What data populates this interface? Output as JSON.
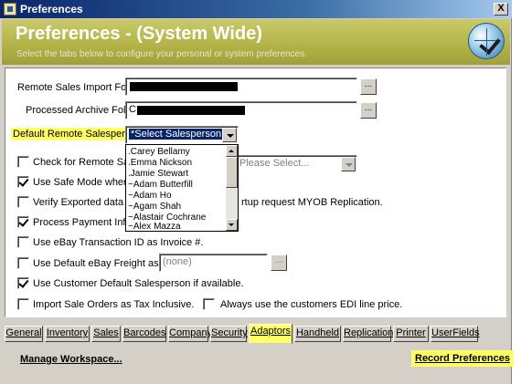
{
  "window": {
    "title": "Preferences",
    "close_label": "X"
  },
  "header": {
    "title": "Preferences - (System Wide)",
    "subtitle": "Select the tabs below to configure your personal or system preferences."
  },
  "fields": {
    "remote_import_label": "Remote Sales Import Folder :",
    "processed_archive_label": "Processed Archive Folder :",
    "processed_archive_value_prefix": "C",
    "default_salesperson_label": "Default Remote Salesperson :",
    "default_salesperson_value": "*Select Salesperson",
    "browse_label": "...",
    "please_select": "Please Select...",
    "freight_item_value": "(none)"
  },
  "salesperson_options": [
    ".Carey Bellamy",
    ".Emma Nickson",
    ".Jamie Stewart",
    "~Adam Butterfill",
    "~Adam Ho",
    "~Agam Shah",
    "~Alastair Cochrane",
    "~Alex Mazza"
  ],
  "checkboxes": [
    {
      "label": "Check for Remote Sales at",
      "checked": false
    },
    {
      "label": "Use Safe Mode when Expo",
      "checked": true
    },
    {
      "label": "Verify Exported data after N",
      "checked": false
    },
    {
      "label": "Process Payment Informati",
      "checked": true
    },
    {
      "label": "Use eBay Transaction ID as Invoice #.",
      "checked": false
    },
    {
      "label": "Use Default eBay Freight as Item :",
      "checked": false
    },
    {
      "label": "Use Customer Default Salesperson if available.",
      "checked": true
    },
    {
      "label": "Import Sale Orders as Tax Inclusive.",
      "checked": false
    },
    {
      "label": "Always use the customers EDI line price.",
      "checked": false
    }
  ],
  "startup_text": "rtup request MYOB Replication.",
  "tabs": [
    "General",
    "Inventory",
    "Sales",
    "Barcodes",
    "Company",
    "Security",
    "Adaptors",
    "Handheld",
    "Replication",
    "Printer",
    "UserFields"
  ],
  "active_tab": "Adaptors",
  "footer": {
    "manage_workspace": "Manage Workspace...",
    "record_preferences": "Record Preferences"
  },
  "colors": {
    "highlight": "#ffff66",
    "header": "#b4b44a",
    "titlebar": "#0a246a"
  }
}
